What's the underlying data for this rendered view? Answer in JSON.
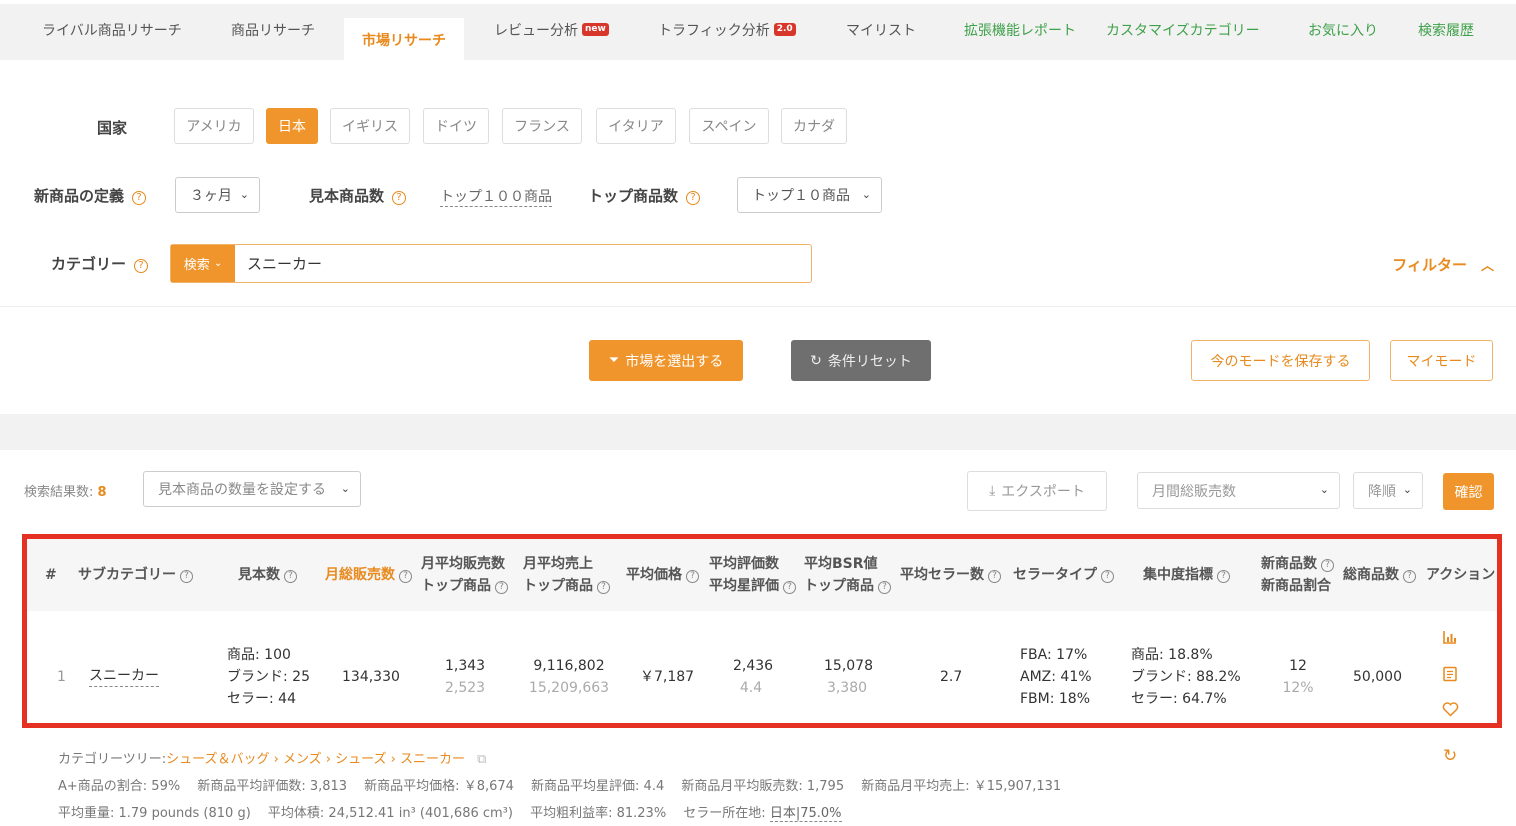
{
  "tabs": [
    {
      "label": "ライバル商品リサーチ"
    },
    {
      "label": "商品リサーチ"
    },
    {
      "label": "市場リサーチ"
    },
    {
      "label": "レビュー分析",
      "badge": "new"
    },
    {
      "label": "トラフィック分析",
      "badge": "2.0"
    },
    {
      "label": "マイリスト"
    },
    {
      "label": "拡張機能レポート"
    },
    {
      "label": "カスタマイズカテゴリー"
    },
    {
      "label": "お気に入り"
    },
    {
      "label": "検索履歴"
    }
  ],
  "country": {
    "label": "国家",
    "options": [
      "アメリカ",
      "日本",
      "イギリス",
      "ドイツ",
      "フランス",
      "イタリア",
      "スペイン",
      "カナダ"
    ],
    "selected": "日本"
  },
  "new_product_def": {
    "label": "新商品の定義",
    "value": "３ヶ月"
  },
  "sample_count": {
    "label": "見本商品数",
    "value": "トップ１００商品"
  },
  "top_count": {
    "label": "トップ商品数",
    "value": "トップ１０商品"
  },
  "category": {
    "label": "カテゴリー",
    "mode": "検索",
    "value": "スニーカー"
  },
  "filter_label": "フィルター",
  "actions": {
    "select_market": "市場を選出する",
    "reset": "条件リセット",
    "save_mode": "今のモードを保存する",
    "my_mode": "マイモード"
  },
  "results": {
    "count_label": "検索結果数:",
    "count": "8",
    "sample_qty_placeholder": "見本商品の数量を設定する",
    "export": "エクスポート",
    "sort_field": "月間総販売数",
    "sort_order": "降順",
    "confirm": "確認"
  },
  "table": {
    "headers": {
      "no": "#",
      "subcategory": "サブカテゴリー",
      "samples": "見本数",
      "monthly_sales": "月総販売数",
      "avg_monthly_sales_1": "月平均販売数",
      "avg_monthly_sales_2": "トップ商品",
      "avg_revenue_1": "月平均売上",
      "avg_revenue_2": "トップ商品",
      "avg_price": "平均価格",
      "avg_reviews_1": "平均評価数",
      "avg_reviews_2": "平均星評価",
      "avg_bsr_1": "平均BSR値",
      "avg_bsr_2": "トップ商品",
      "avg_sellers": "平均セラー数",
      "seller_type": "セラータイプ",
      "concentration": "集中度指標",
      "new_products_1": "新商品数",
      "new_products_2": "新商品割合",
      "total_products": "総商品数",
      "actions": "アクション"
    },
    "row": {
      "no": "1",
      "subcategory": "スニーカー",
      "samples": [
        "商品: 100",
        "ブランド: 25",
        "セラー: 44"
      ],
      "monthly_sales": "134,330",
      "avg_monthly_sales": "1,343",
      "avg_monthly_sales_top": "2,523",
      "avg_revenue": "9,116,802",
      "avg_revenue_top": "15,209,663",
      "avg_price": "￥7,187",
      "avg_reviews": "2,436",
      "avg_stars": "4.4",
      "avg_bsr": "15,078",
      "avg_bsr_top": "3,380",
      "avg_sellers": "2.7",
      "seller_type": [
        "FBA: 17%",
        "AMZ: 41%",
        "FBM: 18%"
      ],
      "concentration": [
        "商品: 18.8%",
        "ブランド: 88.2%",
        "セラー: 64.7%"
      ],
      "new_products": "12",
      "new_ratio": "12%",
      "total_products": "50,000"
    }
  },
  "footer": {
    "tree_label": "カテゴリーツリー:",
    "tree": "シューズ＆バッグ › メンズ › シューズ › スニーカー",
    "line2": "A+商品の割合: 59%　 新商品平均評価数: 3,813　 新商品平均価格: ￥8,674　 新商品平均星評価: 4.4　 新商品月平均販売数: 1,795　 新商品月平均売上: ￥15,907,131",
    "line3_a": "平均重量: 1.79 pounds (810 g)　 平均体積: 24,512.41 in³ (401,686 cm³)　 平均粗利益率: 81.23%　 セラー所在地: ",
    "line3_b": "日本|75.0%"
  }
}
